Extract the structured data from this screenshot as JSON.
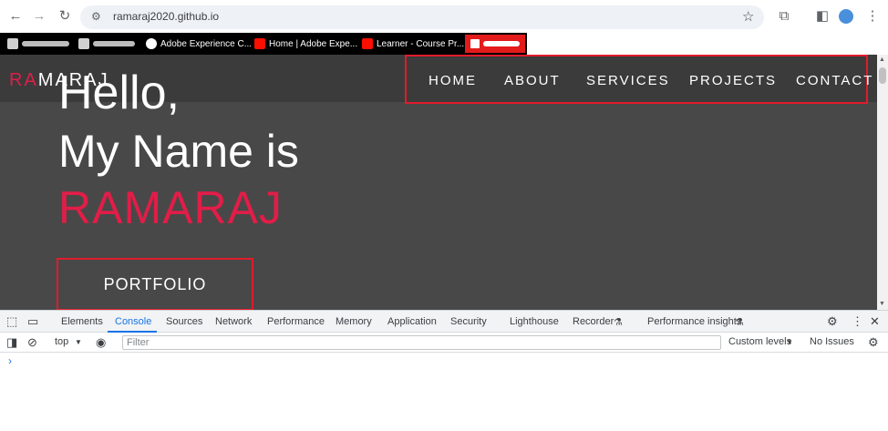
{
  "browser": {
    "url": "ramaraj2020.github.io",
    "back_icon": "arrow-left-icon",
    "forward_icon": "arrow-right-icon",
    "reload_icon": "reload-icon",
    "bookmarks": [
      {
        "label": "",
        "icon": "blurred-favicon"
      },
      {
        "label": "",
        "icon": "blurred-favicon"
      },
      {
        "label": "Adobe Experience C...",
        "icon": "globe-icon"
      },
      {
        "label": "Home | Adobe Expe...",
        "icon": "adobe-icon"
      },
      {
        "label": "Learner - Course Pr...",
        "icon": "adobe-icon"
      }
    ]
  },
  "site": {
    "logo_red": "RA",
    "logo_white": "MARAJ",
    "nav": [
      "HOME",
      "ABOUT",
      "SERVICES",
      "PROJECTS",
      "CONTACT"
    ],
    "hello": "Hello,",
    "my_name_is": "My Name is",
    "name": "RAMARAJ",
    "portfolio_button": "PORTFOLIO",
    "accent_color": "#e11d48",
    "background_color": "#484848"
  },
  "devtools": {
    "tabs": [
      "Elements",
      "Console",
      "Sources",
      "Network",
      "Performance",
      "Memory",
      "Application",
      "Security",
      "Lighthouse",
      "Recorder",
      "Performance insights"
    ],
    "active_tab": "Console",
    "context": "top",
    "filter_placeholder": "Filter",
    "levels": "Custom levels",
    "issues": "No Issues",
    "prompt": "›"
  }
}
